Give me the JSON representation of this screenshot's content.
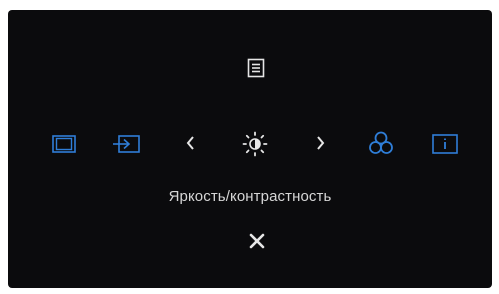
{
  "osd": {
    "title": "Яркость/контрастность",
    "icons": {
      "menu": "menu-icon",
      "input_source": "input-source-icon",
      "preset_modes": "preset-modes-icon",
      "prev": "chevron-left-icon",
      "brightness": "brightness-icon",
      "next": "chevron-right-icon",
      "color": "color-icon",
      "info": "info-icon",
      "close": "close-icon"
    },
    "colors": {
      "background": "#0b0b0d",
      "accent": "#2f7ed8",
      "foreground": "#e6e6e6"
    }
  }
}
